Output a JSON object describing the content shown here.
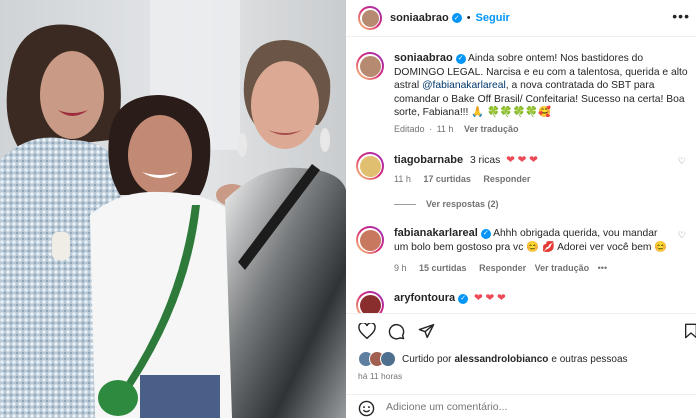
{
  "post": {
    "username": "soniaabrao",
    "follow_label": "Seguir",
    "caption_user": "soniaabrao",
    "caption_a": "Ainda sobre ontem! Nos bastidores do DOMINGO LEGAL. Narcisa e eu com a talentosa, querida e alto astral",
    "caption_mention": "@fabianakarlareal",
    "caption_b": ", a nova contratada do SBT para comandar o Bake Off Brasil/ Confeitaria! Sucesso na certa! Boa sorte, Fabiana!!!",
    "caption_emojis": "🙏 🍀🍀🍀🍀🥰",
    "caption_edited": "Editado",
    "caption_time": "11 h",
    "see_translation": "Ver tradução"
  },
  "comments": [
    {
      "user": "tiagobarnabe",
      "text": "3 ricas",
      "hearts": "❤ ❤ ❤",
      "time": "11 h",
      "likes": "17 curtidas",
      "reply": "Responder",
      "view_replies": "Ver respostas (2)"
    },
    {
      "user": "fabianakarlareal",
      "text_a": "Ahhh obrigada querida, vou mandar um bolo bem gostoso pra vc",
      "text_b": "Adorei ver você bem",
      "emoji_a": "😊",
      "emoji_b": "💋",
      "emoji_c": "😊",
      "time": "9 h",
      "likes": "15 curtidas",
      "reply": "Responder",
      "translate": "Ver tradução",
      "more": "•••"
    },
    {
      "user": "aryfontoura",
      "hearts": "❤ ❤ ❤"
    }
  ],
  "likes": {
    "prefix": "Curtido por",
    "user": "alessandrolobianco",
    "suffix": "e outras pessoas",
    "time": "há 11 horas"
  },
  "comment_box": {
    "placeholder": "Adicione um comentário...",
    "emoji_icon": "smiley-icon"
  },
  "colors": {
    "accent": "#0095f6",
    "heart": "#ed4956",
    "link": "#00376b"
  }
}
